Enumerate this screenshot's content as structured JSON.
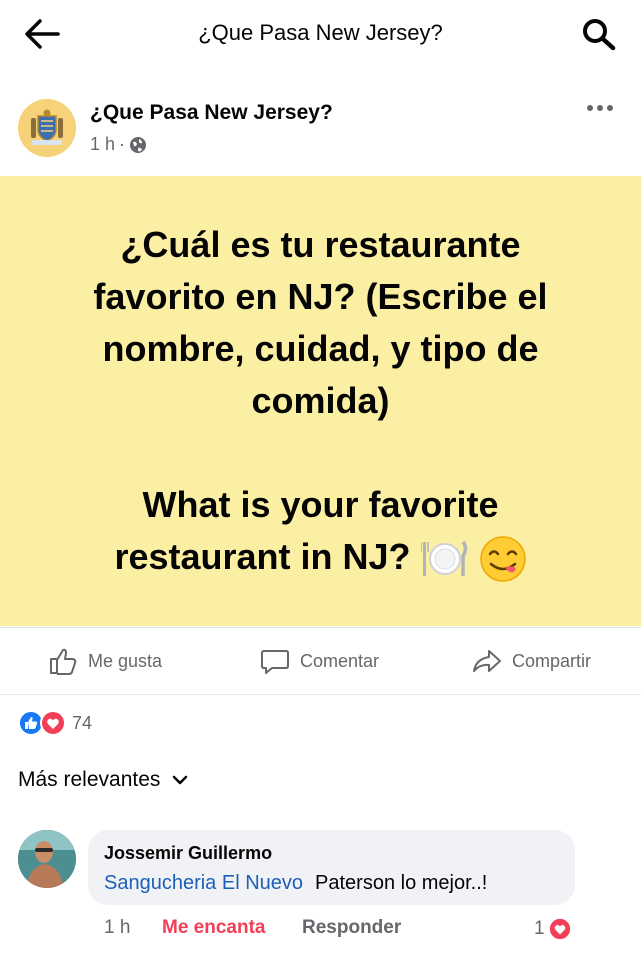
{
  "topbar": {
    "title": "¿Que Pasa New Jersey?"
  },
  "post": {
    "page_name": "¿Que Pasa New Jersey?",
    "time": "1 h",
    "separator": "·",
    "banner_line1": "¿Cuál es tu restaurante favorito en NJ? (Escribe el nombre, cuidad, y tipo de comida)",
    "banner_line2": "What is your favorite restaurant in NJ?",
    "banner_bg": "#fbefa4"
  },
  "actions": {
    "like": "Me gusta",
    "comment": "Comentar",
    "share": "Compartir"
  },
  "reactions": {
    "count": "74",
    "icons": [
      "like-icon",
      "love-icon"
    ]
  },
  "comments_sort": {
    "label": "Más relevantes"
  },
  "comment": {
    "author": "Jossemir Guillermo",
    "mention": "Sangucheria El Nuevo",
    "text": "Paterson lo mejor..!",
    "time": "1 h",
    "reaction_label": "Me encanta",
    "reply": "Responder",
    "reaction_count": "1"
  },
  "colors": {
    "link": "#1d5fb8",
    "love": "#f33e58",
    "like": "#1877f2",
    "muted": "#65676b"
  }
}
